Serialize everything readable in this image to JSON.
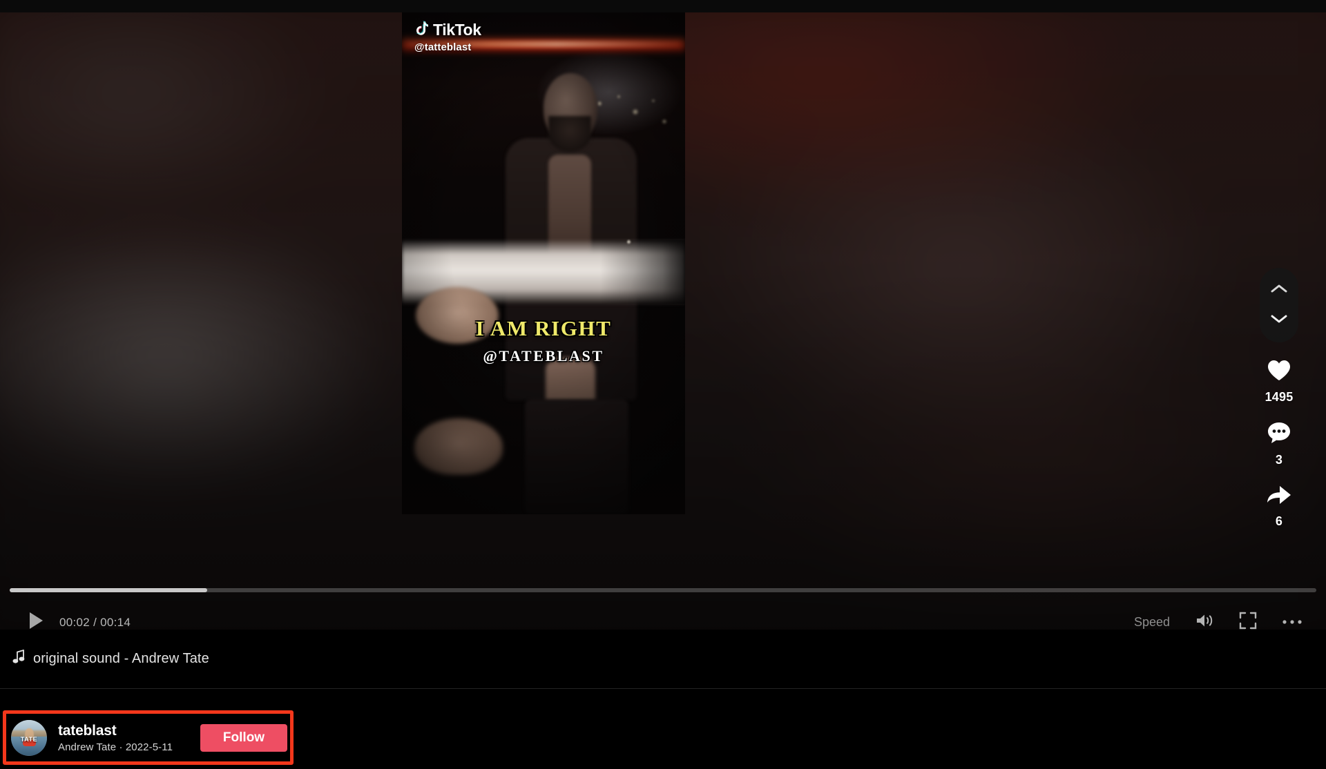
{
  "video": {
    "watermark_brand": "TikTok",
    "watermark_user": "@tatteblast",
    "caption_main": "I AM RIGHT",
    "caption_sub": "@TATEBLAST"
  },
  "sidebar": {
    "prev_icon": "chevron-up-icon",
    "next_icon": "chevron-down-icon",
    "like_icon": "heart-icon",
    "like_count": "1495",
    "comment_icon": "comment-icon",
    "comment_count": "3",
    "share_icon": "share-icon",
    "share_count": "6"
  },
  "player": {
    "play_icon": "play-icon",
    "current_time": "00:02",
    "total_time": "00:14",
    "time_display": "00:02 / 00:14",
    "progress_percent": 15.1,
    "speed_label": "Speed",
    "volume_icon": "volume-icon",
    "fullscreen_icon": "fullscreen-icon",
    "more_icon": "more-options-icon"
  },
  "music": {
    "note_icon": "music-note-icon",
    "title": "original sound - Andrew Tate"
  },
  "profile": {
    "avatar_label": "TATE",
    "username": "tateblast",
    "meta": "Andrew Tate · 2022-5-11",
    "follow_label": "Follow"
  },
  "colors": {
    "follow_button": "#ee4e63",
    "annotation_box": "#f4371b",
    "caption_yellow": "#efe96a",
    "progress_fill": "#c9c9c9"
  }
}
